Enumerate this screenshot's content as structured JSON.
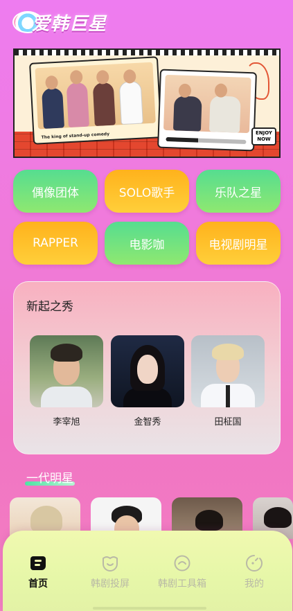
{
  "app": {
    "logo_text": "爱韩巨星"
  },
  "banner": {
    "caption": "The king of stand-up comedy",
    "badge_line1": "ENJOY",
    "badge_line2": "NOW"
  },
  "categories": [
    {
      "label": "偶像团体",
      "style": "green"
    },
    {
      "label": "SOLO歌手",
      "style": "orange"
    },
    {
      "label": "乐队之星",
      "style": "green"
    },
    {
      "label": "RAPPER",
      "style": "orange"
    },
    {
      "label": "电影咖",
      "style": "green"
    },
    {
      "label": "电视剧明星",
      "style": "orange"
    }
  ],
  "rising": {
    "title": "新起之秀",
    "stars": [
      {
        "name": "李宰旭"
      },
      {
        "name": "金智秀"
      },
      {
        "name": "田柾国"
      }
    ]
  },
  "generation": {
    "title": "一代明星"
  },
  "nav": {
    "items": [
      {
        "label": "首页",
        "icon": "home-icon",
        "active": true
      },
      {
        "label": "韩剧投屏",
        "icon": "cast-icon",
        "active": false
      },
      {
        "label": "韩剧工具箱",
        "icon": "toolbox-icon",
        "active": false
      },
      {
        "label": "我的",
        "icon": "profile-icon",
        "active": false
      }
    ]
  },
  "colors": {
    "background_top": "#ee7cf0",
    "background_bottom": "#f27fc1",
    "green_button": "#56dd90",
    "orange_button": "#ffb21c",
    "nav_background": "#f0f9b0"
  }
}
